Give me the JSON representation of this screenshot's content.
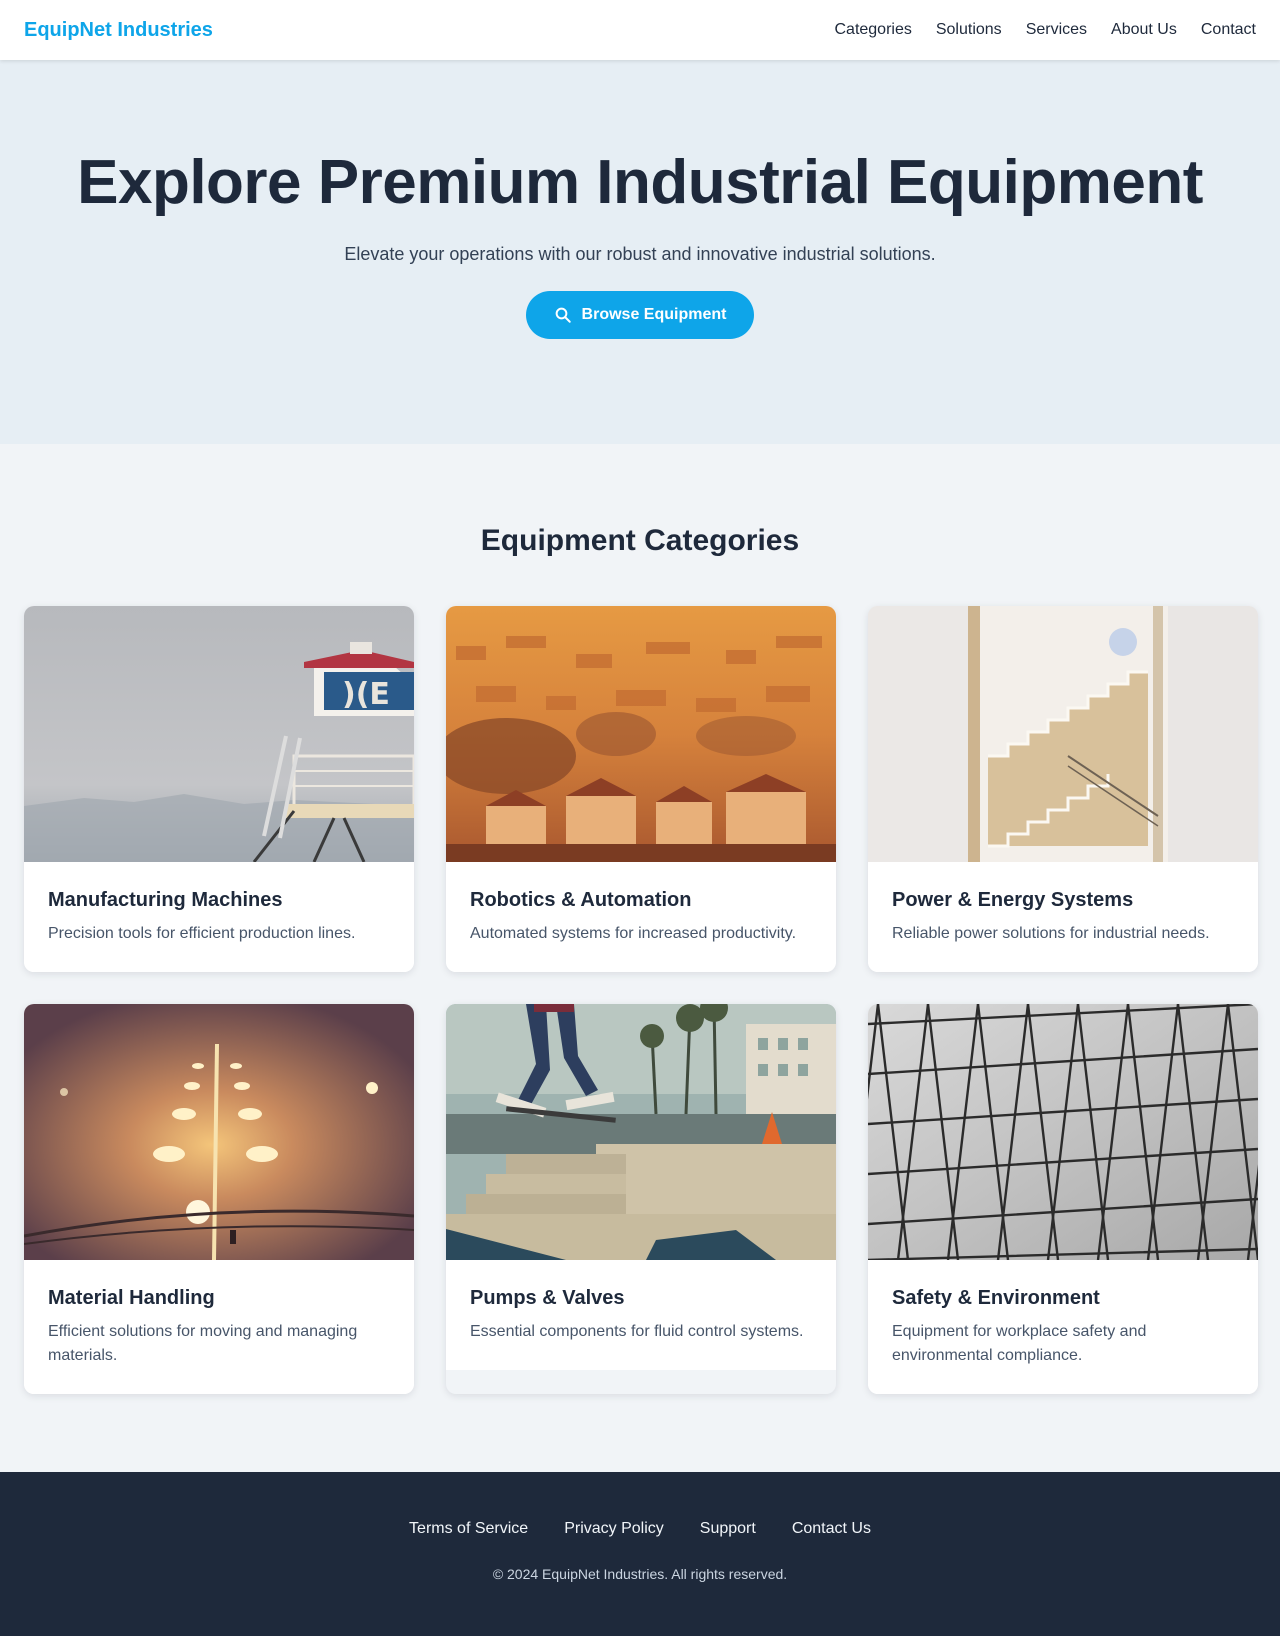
{
  "header": {
    "brand": "EquipNet Industries",
    "nav": [
      "Categories",
      "Solutions",
      "Services",
      "About Us",
      "Contact"
    ]
  },
  "hero": {
    "title": "Explore Premium Industrial Equipment",
    "subtitle": "Elevate your operations with our robust and innovative industrial solutions.",
    "cta_label": "Browse Equipment",
    "cta_icon": "search-icon"
  },
  "categories": {
    "heading": "Equipment Categories",
    "items": [
      {
        "title": "Manufacturing Machines",
        "description": "Precision tools for efficient production lines."
      },
      {
        "title": "Robotics & Automation",
        "description": "Automated systems for increased productivity."
      },
      {
        "title": "Power & Energy Systems",
        "description": "Reliable power solutions for industrial needs."
      },
      {
        "title": "Material Handling",
        "description": "Efficient solutions for moving and managing materials."
      },
      {
        "title": "Pumps & Valves",
        "description": "Essential components for fluid control systems."
      },
      {
        "title": "Safety & Environment",
        "description": "Equipment for workplace safety and environmental compliance."
      }
    ]
  },
  "footer": {
    "links": [
      "Terms of Service",
      "Privacy Policy",
      "Support",
      "Contact Us"
    ],
    "copyright": "© 2024 EquipNet Industries. All rights reserved."
  },
  "colors": {
    "accent": "#0ea5e9",
    "dark": "#1e293b",
    "hero_bg": "#e6eef4",
    "page_bg": "#f1f4f7"
  }
}
